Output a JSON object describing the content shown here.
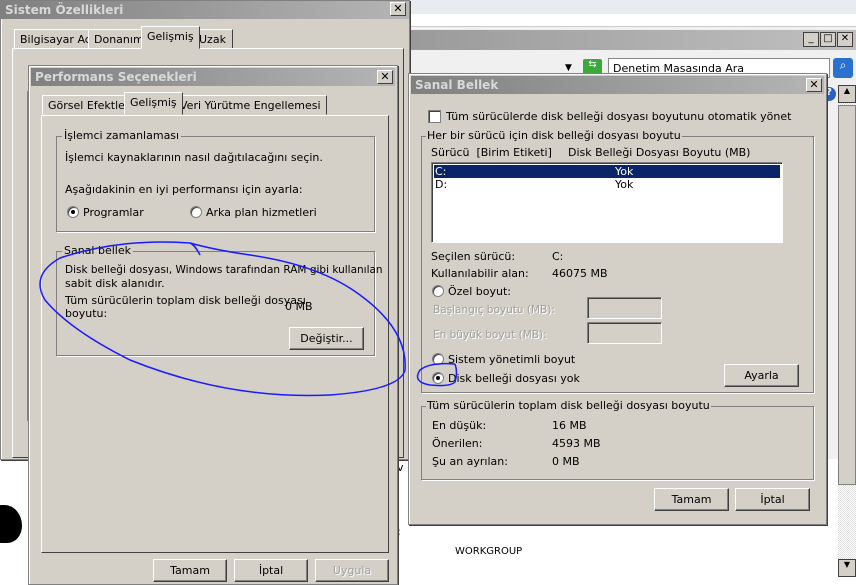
{
  "control_panel": {
    "search_placeholder": "Denetim Masasında Ara",
    "workgroup": "WORKGROUP",
    "partial_text_v": "v",
    "partial_text_colon": ":"
  },
  "system_properties": {
    "title": "Sistem Özellikleri",
    "tabs": [
      "Bilgisayar Adı",
      "Donanım",
      "Gelişmiş",
      "Uzak"
    ],
    "active_tab": "Gelişmiş"
  },
  "performance_options": {
    "title": "Performans Seçenekleri",
    "tabs": [
      "Görsel Efektler",
      "Gelişmiş",
      "Veri Yürütme Engellemesi"
    ],
    "active_tab": "Gelişmiş",
    "cpu": {
      "legend": "İşlemci zamanlaması",
      "desc": "İşlemci kaynaklarının nasıl dağıtılacağını seçin.",
      "adjust": "Aşağıdakinin en iyi performansı için ayarla:",
      "opt_programs": "Programlar",
      "opt_background": "Arka plan hizmetleri",
      "selected": "Programlar"
    },
    "vm": {
      "legend": "Sanal bellek",
      "desc1": "Disk belleği dosyası, Windows tarafından RAM gibi kullanılan",
      "desc2": "sabit disk alanıdır.",
      "total_label1": "Tüm sürücülerin toplam disk belleği dosyası",
      "total_label2": "boyutu:",
      "total_value": "0 MB",
      "change": "Değiştir..."
    },
    "buttons": {
      "ok": "Tamam",
      "cancel": "İptal",
      "apply": "Uygula"
    }
  },
  "virtual_memory": {
    "title": "Sanal Bellek",
    "auto_manage": "Tüm sürücülerde disk belleği dosyası boyutunu otomatik yönet",
    "auto_manage_checked": false,
    "per_drive_legend": "Her bir sürücü için disk belleği dosyası boyutu",
    "col_drive": "Sürücü  [Birim Etiketi]",
    "col_size": "Disk Belleği Dosyası Boyutu (MB)",
    "drives": [
      {
        "drive": "C:",
        "size": "Yok",
        "selected": true
      },
      {
        "drive": "D:",
        "size": "Yok",
        "selected": false
      }
    ],
    "selected_drive_label": "Seçilen sürücü:",
    "selected_drive": "C:",
    "free_space_label": "Kullanılabilir alan:",
    "free_space": "46075 MB",
    "opt_custom": "Özel boyut:",
    "initial_label": "Başlangıç boyutu (MB):",
    "max_label": "En büyük boyut (MB):",
    "opt_system": "Sistem yönetimli boyut",
    "opt_none": "Disk belleği dosyası yok",
    "selected_option": "Disk belleği dosyası yok",
    "set": "Ayarla",
    "total_legend": "Tüm sürücülerin toplam disk belleği dosyası boyutu",
    "min_label": "En düşük:",
    "min": "16 MB",
    "rec_label": "Önerilen:",
    "rec": "4593 MB",
    "cur_label": "Şu an ayrılan:",
    "cur": "0 MB",
    "ok": "Tamam",
    "cancel": "İptal"
  },
  "colors": {
    "selection": "#0a246a",
    "annotation": "#1a1aff",
    "dialog": "#d4d0c8"
  }
}
